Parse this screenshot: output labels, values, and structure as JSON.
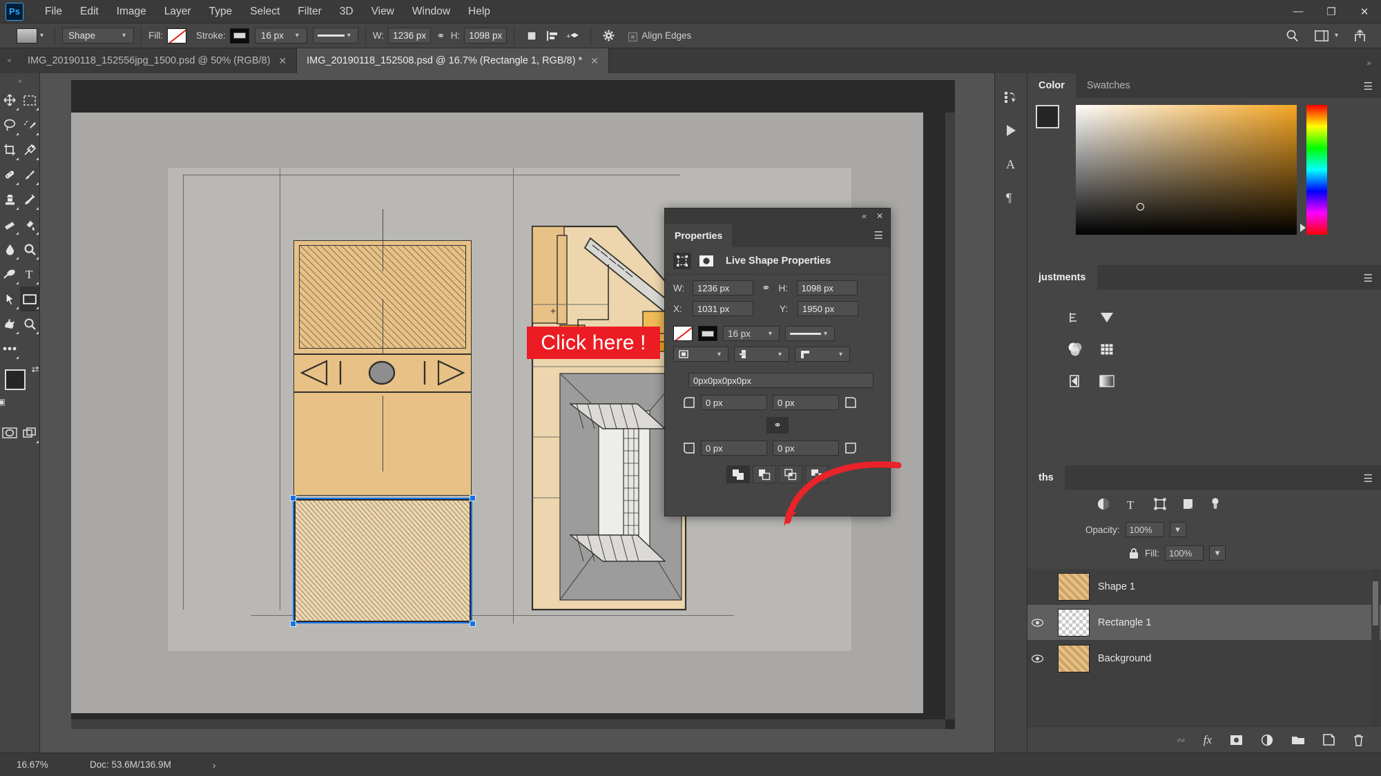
{
  "app": {
    "logo": "Ps",
    "menus": [
      "File",
      "Edit",
      "Image",
      "Layer",
      "Type",
      "Select",
      "Filter",
      "3D",
      "View",
      "Window",
      "Help"
    ],
    "window_controls": {
      "minimize": "—",
      "maximize": "❐",
      "close": "✕"
    }
  },
  "options_bar": {
    "tool_preset_name": "shape-tool-preset",
    "mode_value": "Shape",
    "fill_label": "Fill:",
    "stroke_label": "Stroke:",
    "stroke_width": "16 px",
    "width_label": "W:",
    "width_value": "1236 px",
    "link_glyph": "⚭",
    "height_label": "H:",
    "height_value": "1098 px",
    "align_edges_label": "Align Edges",
    "search_icon": "search-icon",
    "workspace_icon": "workspace-icon",
    "share_icon": "share-icon"
  },
  "tabs": [
    {
      "label": "IMG_20190118_152556jpg_1500.psd @ 50% (RGB/8)",
      "close": "✕",
      "active": false
    },
    {
      "label": "IMG_20190118_152508.psd @ 16.7% (Rectangle 1, RGB/8) *",
      "close": "✕",
      "active": true
    }
  ],
  "toolbar": {
    "tools_left": [
      "move-tool",
      "lasso-tool",
      "crop-tool",
      "healing-brush-tool",
      "clone-stamp-tool",
      "eraser-tool",
      "blur-tool",
      "dodge-tool",
      "path-selection-tool",
      "rotate-view-tool",
      "edit-toolbar-tool"
    ],
    "tools_right": [
      "marquee-tool",
      "quick-selection-tool",
      "eyedropper-tool",
      "brush-tool",
      "history-brush-tool",
      "gradient-tool",
      "sharpen-tool",
      "type-tool",
      "rectangle-tool",
      "zoom-tool"
    ],
    "selected_tool": "rectangle-tool",
    "foreground_color": "#262626",
    "background_color": "#f7dd9c",
    "quick_mask": "quick-mask-icon",
    "screen_mode": "screen-mode-icon"
  },
  "properties_panel": {
    "tab_label": "Properties",
    "collapse_glyph": "«",
    "close_glyph": "✕",
    "menu_glyph": "☰",
    "section_title": "Live Shape Properties",
    "w_label": "W:",
    "w_value": "1236 px",
    "link_glyph": "⚭",
    "h_label": "H:",
    "h_value": "1098 px",
    "x_label": "X:",
    "x_value": "1031 px",
    "y_label": "Y:",
    "y_value": "1950 px",
    "stroke_width": "16 px",
    "corner_summary": "0px0px0px0px",
    "corner_tl": "0 px",
    "corner_tr": "0 px",
    "corner_bl": "0 px",
    "corner_br": "0 px",
    "link_corners_glyph": "⚭",
    "path_ops": [
      "combine-shapes",
      "subtract-front-shape",
      "intersect-shapes",
      "exclude-overlapping-shapes"
    ],
    "fill_swatch": "no-fill-swatch",
    "stroke_swatch": "stroke-color-swatch"
  },
  "annotation": {
    "text": "Click here !",
    "color": "#ec1c24"
  },
  "color_panel": {
    "tabs": [
      "Color",
      "Swatches"
    ],
    "active_tab": "Color",
    "menu_glyph": "☰",
    "foreground_color": "#262626",
    "background_color": "#f7dd9c",
    "field_accent": "#f6a623"
  },
  "adjustments_panel": {
    "tab_label": "justments",
    "menu_glyph": "☰",
    "icons": [
      "levels-icon",
      "curves-icon",
      "exposure-icon",
      "vibrance-icon",
      "hue-saturation-icon",
      "color-balance-icon",
      "black-white-icon",
      "photo-filter-icon",
      "channel-mixer-icon",
      "gradient-map-icon"
    ]
  },
  "layers_panel": {
    "tab_label": "ths",
    "menu_glyph": "☰",
    "filter_icons": [
      "pixel-filter-icon",
      "adjustment-filter-icon",
      "type-filter-icon",
      "shape-filter-icon",
      "smart-object-filter-icon",
      "filter-toggle-icon"
    ],
    "opacity_label": "Opacity:",
    "opacity_value": "100%",
    "fill_label": "Fill:",
    "fill_value": "100%",
    "lock_icon": "lock-icon",
    "layers": [
      {
        "name": "Shape 1",
        "visible": false,
        "selected": false,
        "thumb": "tan"
      },
      {
        "name": "Rectangle 1",
        "visible": true,
        "selected": true,
        "thumb": "checker"
      },
      {
        "name": "Background",
        "visible": true,
        "selected": false,
        "thumb": "tan"
      }
    ],
    "bottom_icons": [
      "link-layers-icon",
      "layer-style-icon",
      "layer-mask-icon",
      "adjustment-layer-icon",
      "new-group-icon",
      "new-layer-icon",
      "delete-layer-icon"
    ]
  },
  "status_bar": {
    "zoom": "16.67%",
    "doc": "Doc: 53.6M/136.9M",
    "expand_glyph": "›"
  },
  "artwork": {
    "description": "hand-drawn architectural elevation and section sketch, tan/ochre marker on gray paper",
    "selection_color": "#1473e6"
  }
}
